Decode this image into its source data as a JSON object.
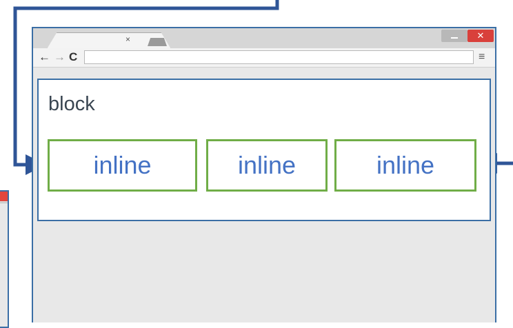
{
  "browser": {
    "tab_close_glyph": "×",
    "close_glyph": "✕",
    "back_glyph": "←",
    "forward_glyph": "→",
    "reload_glyph": "C",
    "menu_glyph": "≡",
    "address_value": ""
  },
  "diagram": {
    "block_label": "block",
    "inline_boxes": [
      {
        "label": "inline"
      },
      {
        "label": "inline"
      },
      {
        "label": "inline"
      }
    ]
  },
  "colors": {
    "block_border": "#3a6ea5",
    "inline_border": "#70ad47",
    "inline_text": "#4472c4",
    "connector": "#2f5597"
  }
}
